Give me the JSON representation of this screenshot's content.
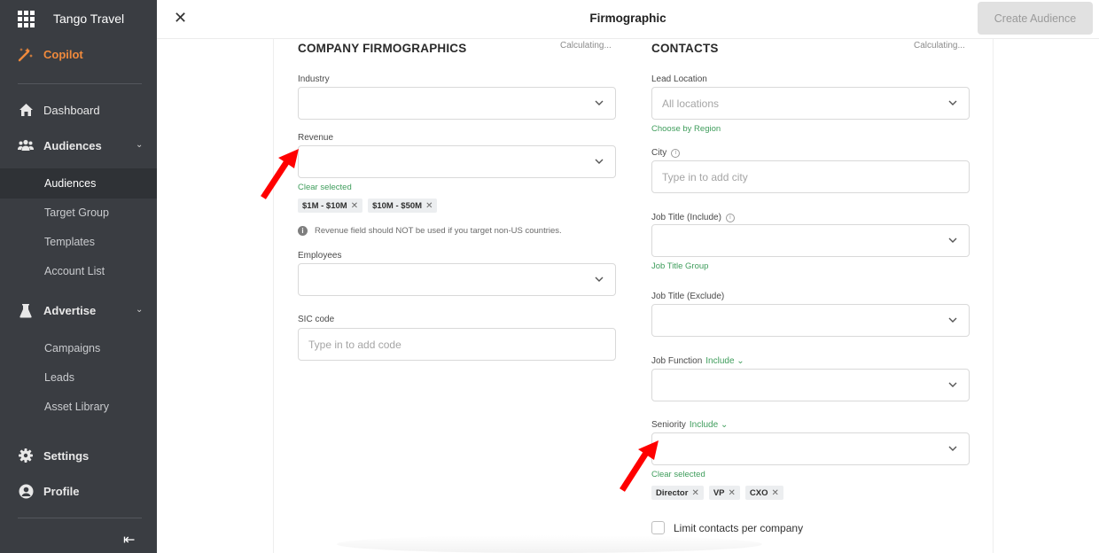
{
  "sidebar": {
    "brand": "Tango Travel",
    "copilot": "Copilot",
    "items": [
      {
        "label": "Dashboard"
      },
      {
        "label": "Audiences"
      },
      {
        "label": "Advertise"
      },
      {
        "label": "Settings"
      },
      {
        "label": "Profile"
      }
    ],
    "audiences_sub": [
      "Audiences",
      "Target Group",
      "Templates",
      "Account List"
    ],
    "advertise_sub": [
      "Campaigns",
      "Leads",
      "Asset Library"
    ]
  },
  "topbar": {
    "title": "Firmographic",
    "create_label": "Create Audience"
  },
  "company": {
    "title": "COMPANY FIRMOGRAPHICS",
    "status": "Calculating...",
    "industry_label": "Industry",
    "revenue_label": "Revenue",
    "revenue_clear": "Clear selected",
    "revenue_chips": [
      "$1M - $10M",
      "$10M - $50M"
    ],
    "revenue_note": "Revenue field should NOT be used if you target non-US countries.",
    "employees_label": "Employees",
    "sic_label": "SIC code",
    "sic_placeholder": "Type in to add code"
  },
  "contacts": {
    "title": "CONTACTS",
    "status": "Calculating...",
    "lead_location_label": "Lead Location",
    "lead_location_placeholder": "All locations",
    "choose_region": "Choose by Region",
    "city_label": "City",
    "city_placeholder": "Type in to add city",
    "job_title_include_label": "Job Title (Include)",
    "job_title_group": "Job Title Group",
    "job_title_exclude_label": "Job Title (Exclude)",
    "job_function_label": "Job Function",
    "job_function_mode": "Include",
    "seniority_label": "Seniority",
    "seniority_mode": "Include",
    "seniority_clear": "Clear selected",
    "seniority_chips": [
      "Director",
      "VP",
      "CXO"
    ],
    "limit_label": "Limit contacts per company"
  },
  "colors": {
    "sidebar_bg": "#3a3d42",
    "accent_orange": "#f08a3c",
    "accent_green": "#3f9d5c",
    "annotation_red": "#ff0000"
  }
}
